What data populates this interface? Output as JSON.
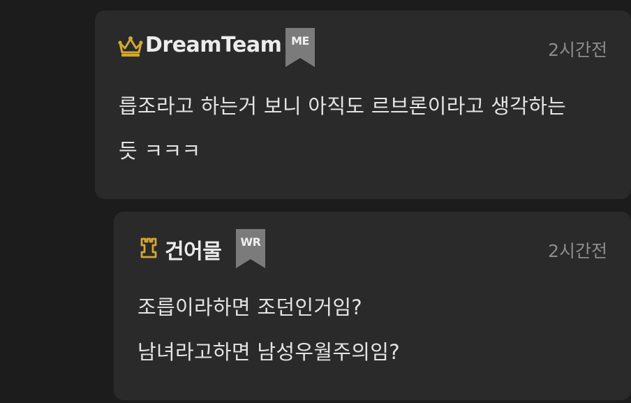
{
  "comments": [
    {
      "author": "DreamTeam",
      "rank_icon": "crown-icon",
      "badge": "ME",
      "timestamp": "2시간전",
      "lines": [
        "릅조라고 하는거 보니 아직도 르브론이라고 생각하는",
        "듯 ㅋㅋㅋ"
      ]
    },
    {
      "author": "건어물",
      "rank_icon": "rook-icon",
      "badge": "WR",
      "timestamp": "2시간전",
      "lines": [
        "조릅이라하면 조던인거임?",
        "남녀라고하면 남성우월주의임?"
      ]
    }
  ],
  "colors": {
    "page_background": "#1c1c1c",
    "card_background": "#2a2a2b",
    "rank_gold": "#d4a92a",
    "badge_gray": "#7b7b7b",
    "author_text": "#ececec",
    "timestamp_text": "#8c8c8c"
  }
}
